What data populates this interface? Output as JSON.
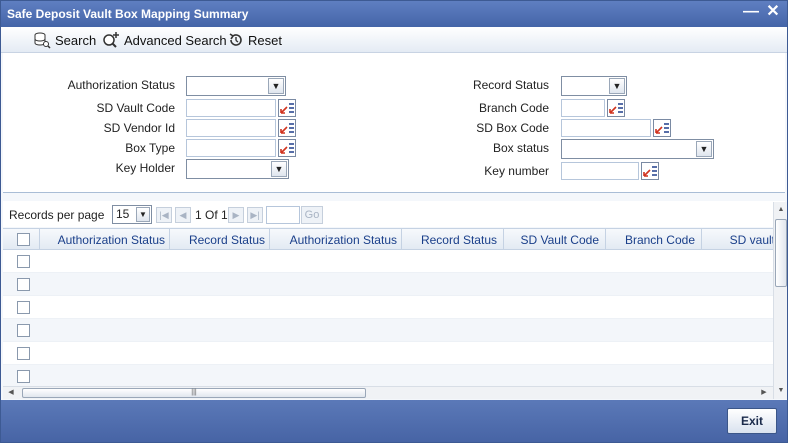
{
  "window": {
    "title": "Safe Deposit Vault Box Mapping Summary"
  },
  "toolbar": {
    "search": "Search",
    "advanced_search": "Advanced Search",
    "reset": "Reset"
  },
  "criteria": {
    "authorization_status": "Authorization Status",
    "sd_vault_code": "SD Vault Code",
    "sd_vendor_id": "SD Vendor Id",
    "box_type": "Box Type",
    "key_holder": "Key Holder",
    "record_status": "Record Status",
    "branch_code": "Branch Code",
    "sd_box_code": "SD Box Code",
    "box_status": "Box status",
    "key_number": "Key number"
  },
  "pager": {
    "records_per_page_label": "Records per page",
    "records_per_page_value": "15",
    "page_info": "1 Of 1",
    "go_label": "Go"
  },
  "grid": {
    "columns": [
      "Authorization Status",
      "Record Status",
      "Authorization Status",
      "Record Status",
      "SD Vault Code",
      "Branch Code",
      "SD vault d"
    ],
    "row_count": 6
  },
  "footer": {
    "exit_label": "Exit"
  },
  "colors": {
    "title_bar": "#4465a8",
    "header_text": "#1a3f8a",
    "footer": "#4764a5"
  }
}
